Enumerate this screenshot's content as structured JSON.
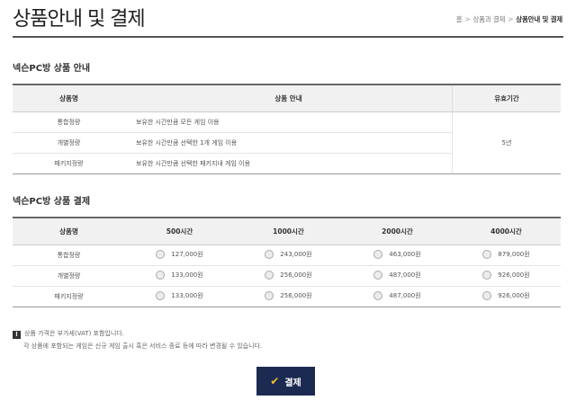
{
  "page": {
    "title": "상품안내 및 결제",
    "breadcrumb": [
      "홈",
      "상품과 결제",
      "상품안내 및 결제"
    ]
  },
  "info_section": {
    "title": "넥슨PC방 상품 안내",
    "headers": [
      "상품명",
      "상품 안내",
      "유효기간"
    ],
    "rows": [
      {
        "name": "통합정량",
        "desc": "보유한 시간만큼 모든 게임 이용"
      },
      {
        "name": "개별정량",
        "desc": "보유한 시간만큼 선택한 1개 게임 이용"
      },
      {
        "name": "패키지정량",
        "desc": "보유한 시간만큼 선택한 패키지내 게임 이용"
      }
    ],
    "period": "5년"
  },
  "price_section": {
    "title": "넥슨PC방 상품 결제",
    "headers": [
      "상품명",
      "500시간",
      "1000시간",
      "2000시간",
      "4000시간"
    ],
    "rows": [
      {
        "name": "통합정량",
        "prices": [
          "127,000원",
          "243,000원",
          "463,000원",
          "879,000원"
        ]
      },
      {
        "name": "개별정량",
        "prices": [
          "133,000원",
          "256,000원",
          "487,000원",
          "926,000원"
        ]
      },
      {
        "name": "패키지정량",
        "prices": [
          "133,000원",
          "256,000원",
          "487,000원",
          "926,000원"
        ]
      }
    ]
  },
  "notice": {
    "badge": "!",
    "line1": "상품 가격은 부가세(VAT) 포함입니다.",
    "line2": "각 상품에 포함되는 게임은 신규 게임 출시 혹은 서비스 종료 등에 따라 변경될 수 있습니다."
  },
  "pay_button": {
    "label": "결제",
    "icon": "check-icon",
    "color": "#1c2a52"
  }
}
